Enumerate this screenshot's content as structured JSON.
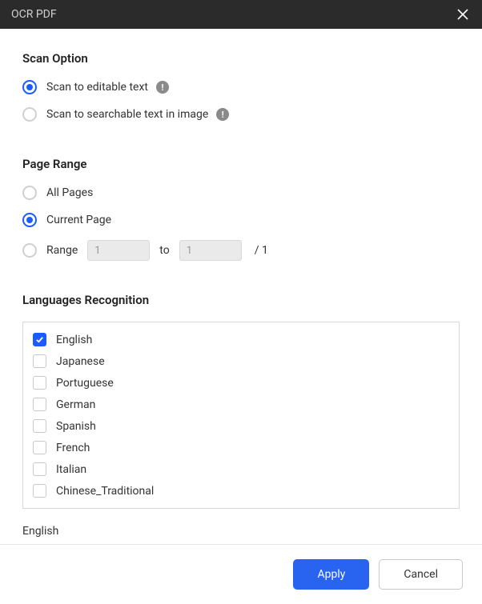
{
  "titlebar": {
    "title": "OCR PDF"
  },
  "scanOption": {
    "title": "Scan Option",
    "editable": "Scan to editable text",
    "searchable": "Scan to searchable text in image"
  },
  "pageRange": {
    "title": "Page Range",
    "all": "All Pages",
    "current": "Current Page",
    "range": "Range",
    "to": "to",
    "from_val": "1",
    "to_val": "1",
    "total": "/ 1"
  },
  "languages": {
    "title": "Languages Recognition",
    "items": [
      {
        "label": "English",
        "checked": true
      },
      {
        "label": "Japanese",
        "checked": false
      },
      {
        "label": "Portuguese",
        "checked": false
      },
      {
        "label": "German",
        "checked": false
      },
      {
        "label": "Spanish",
        "checked": false
      },
      {
        "label": "French",
        "checked": false
      },
      {
        "label": "Italian",
        "checked": false
      },
      {
        "label": "Chinese_Traditional",
        "checked": false
      }
    ],
    "selected": "English"
  },
  "footer": {
    "apply": "Apply",
    "cancel": "Cancel"
  }
}
